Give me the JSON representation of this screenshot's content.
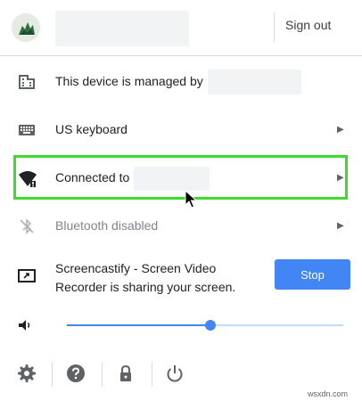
{
  "header": {
    "sign_out_label": "Sign out"
  },
  "items": {
    "managed": {
      "label": "This device is managed by"
    },
    "keyboard": {
      "label": "US keyboard"
    },
    "network": {
      "label": "Connected to"
    },
    "bluetooth": {
      "label": "Bluetooth disabled"
    },
    "cast": {
      "line1": "Screencastify - Screen Video",
      "line2": "Recorder is sharing your screen.",
      "stop_label": "Stop"
    }
  },
  "volume": {
    "level_fraction": 0.52
  },
  "watermark": "wsxdn.com",
  "colors": {
    "accent": "#4285f4",
    "highlight": "#3ddc2b"
  },
  "icons": {
    "managed": "building-icon",
    "keyboard": "keyboard-icon",
    "network": "wifi-icon",
    "bluetooth": "bluetooth-disabled-icon",
    "cast": "screen-share-icon",
    "volume": "speaker-icon",
    "settings": "gear-icon",
    "help": "help-icon",
    "lock": "lock-icon",
    "power": "power-icon"
  }
}
